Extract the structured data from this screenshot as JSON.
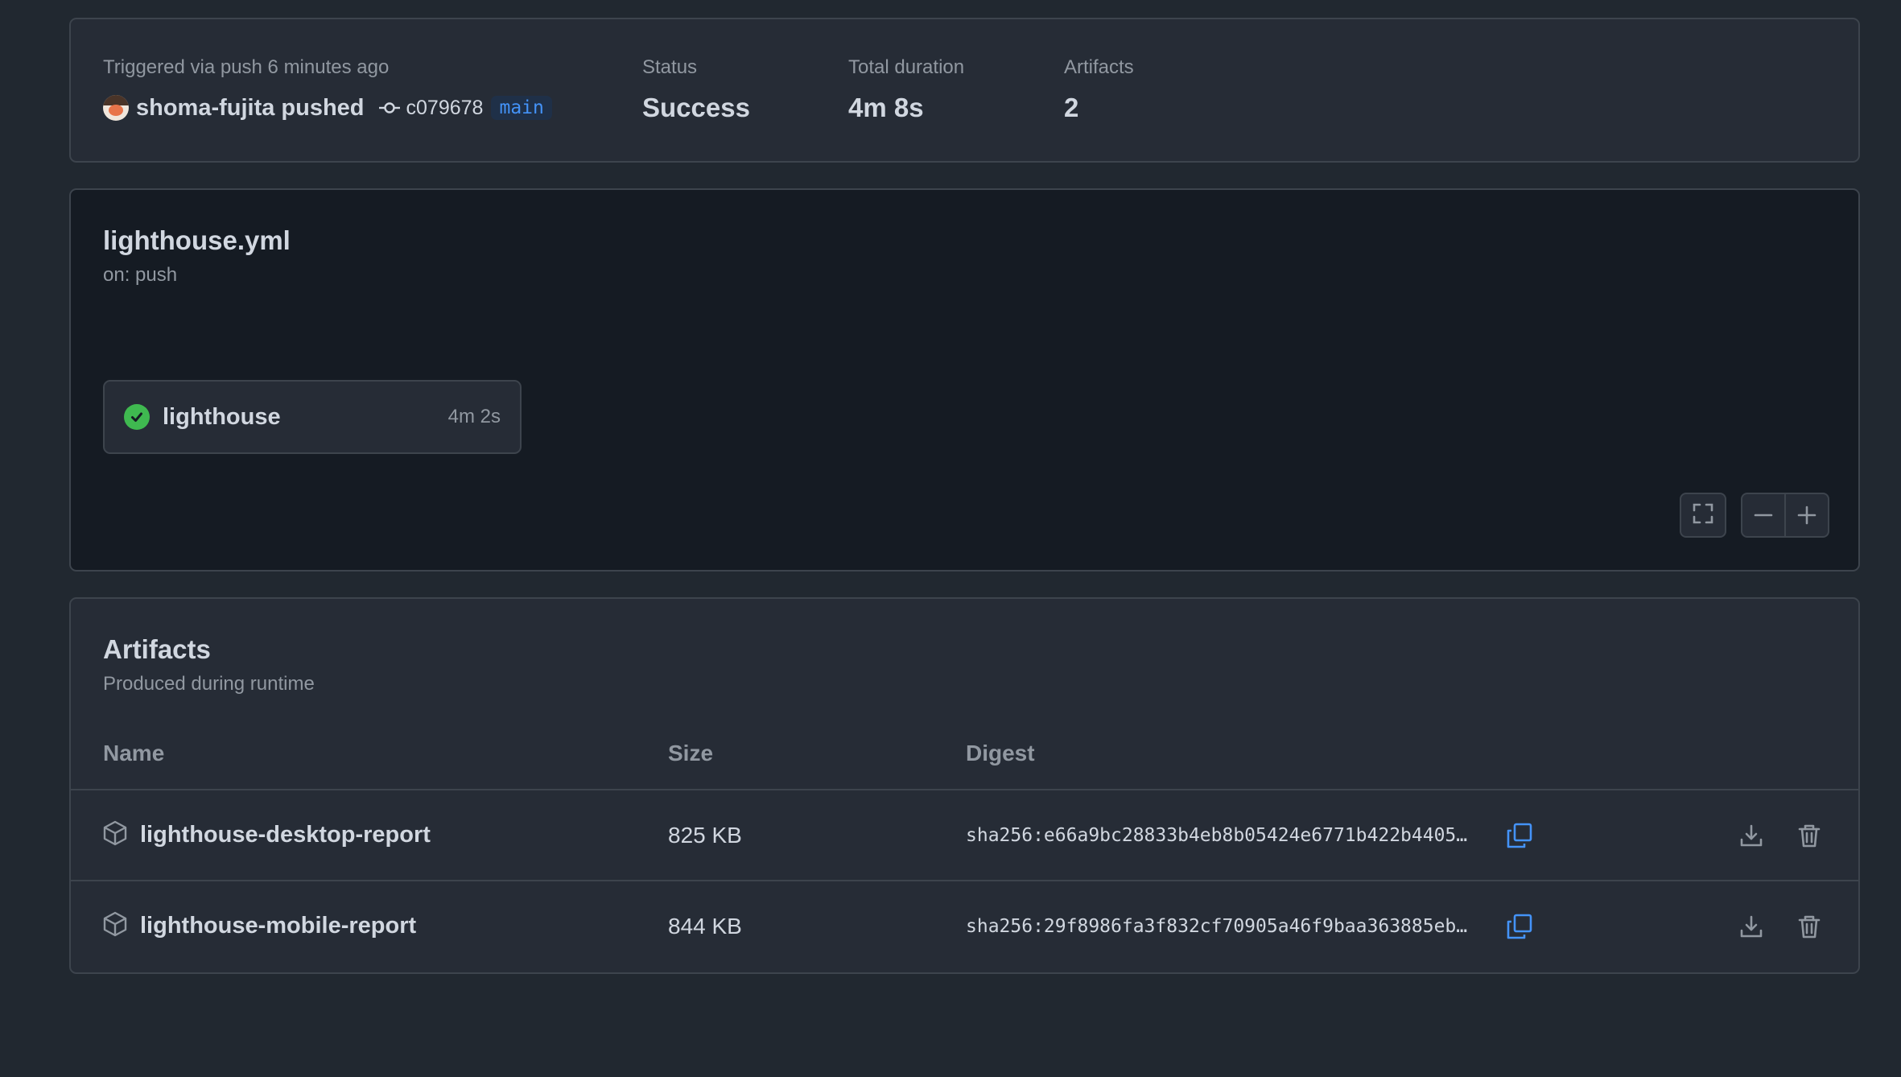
{
  "summary": {
    "trigger_label": "Triggered via push 6 minutes ago",
    "actor": "shoma-fujita",
    "actor_verb": "pushed",
    "commit_sha": "c079678",
    "branch": "main",
    "status_label": "Status",
    "status_value": "Success",
    "duration_label": "Total duration",
    "duration_value": "4m 8s",
    "artifacts_label": "Artifacts",
    "artifacts_value": "2"
  },
  "workflow": {
    "title": "lighthouse.yml",
    "subtitle": "on: push",
    "jobs": [
      {
        "name": "lighthouse",
        "duration": "4m 2s",
        "status": "success"
      }
    ]
  },
  "artifacts": {
    "title": "Artifacts",
    "subtitle": "Produced during runtime",
    "columns": {
      "name": "Name",
      "size": "Size",
      "digest": "Digest"
    },
    "rows": [
      {
        "name": "lighthouse-desktop-report",
        "size": "825 KB",
        "digest": "sha256:e66a9bc28833b4eb8b05424e6771b422b4405…"
      },
      {
        "name": "lighthouse-mobile-report",
        "size": "844 KB",
        "digest": "sha256:29f8986fa3f832cf70905a46f9baa363885eb…"
      }
    ]
  },
  "colors": {
    "background": "#212830",
    "panel": "#262c36",
    "graph_panel": "#151b23",
    "border": "#3d444d",
    "success": "#3fb950",
    "accent": "#4493f8"
  },
  "icons": {
    "commit": "git-commit-icon",
    "check": "check-circle-icon",
    "package": "package-icon",
    "copy": "copy-icon",
    "download": "download-icon",
    "trash": "trash-icon",
    "fullscreen": "fullscreen-icon",
    "zoom_out": "minus-icon",
    "zoom_in": "plus-icon"
  }
}
